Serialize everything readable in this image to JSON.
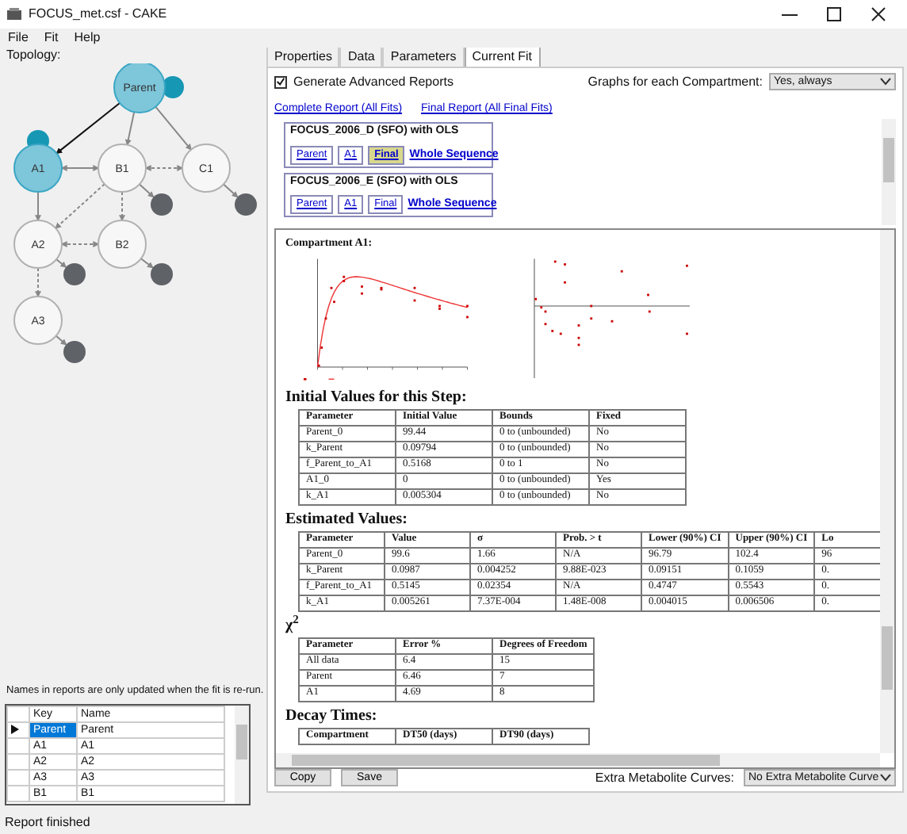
{
  "window": {
    "title": "FOCUS_met.csf - CAKE"
  },
  "menu": [
    "File",
    "Fit",
    "Help"
  ],
  "topology": {
    "label": "Topology:",
    "nodes": [
      {
        "label": "Parent",
        "selected": true,
        "sink": {
          "color": "#1697b4"
        }
      },
      {
        "label": "A1",
        "selected": true,
        "sink": {
          "color": "#1697b4"
        }
      },
      {
        "label": "B1",
        "selected": false,
        "sink": {
          "color": "#5f6266"
        }
      },
      {
        "label": "C1",
        "selected": false,
        "sink": {
          "color": "#5f6266"
        }
      },
      {
        "label": "A2",
        "selected": false,
        "sink": {
          "color": "#5f6266"
        }
      },
      {
        "label": "B2",
        "selected": false,
        "sink": {
          "color": "#5f6266"
        }
      },
      {
        "label": "A3",
        "selected": false,
        "sink": {
          "color": "#5f6266"
        }
      }
    ]
  },
  "names_note": "Names in reports are only updated when the fit is re-run.",
  "names_grid": {
    "columns": [
      "Key",
      "Name"
    ],
    "rows": [
      {
        "key": "Parent",
        "name": "Parent",
        "selected": true
      },
      {
        "key": "A1",
        "name": "A1",
        "selected": false
      },
      {
        "key": "A2",
        "name": "A2",
        "selected": false
      },
      {
        "key": "A3",
        "name": "A3",
        "selected": false
      },
      {
        "key": "B1",
        "name": "B1",
        "selected": false
      }
    ]
  },
  "tabs": [
    {
      "label": "Properties",
      "selected": false
    },
    {
      "label": "Data",
      "selected": false
    },
    {
      "label": "Parameters",
      "selected": false
    },
    {
      "label": "Current Fit",
      "selected": true
    }
  ],
  "advanced_reports": {
    "label": "Generate Advanced Reports",
    "checked": true
  },
  "graphs_setting": {
    "label": "Graphs for each Compartment:",
    "value": "Yes, always"
  },
  "report_links": [
    "Complete Report (All Fits)",
    "Final Report (All Final Fits)"
  ],
  "fits": [
    {
      "title": "FOCUS_2006_D (SFO) with OLS",
      "steps": [
        {
          "label": "Parent",
          "selected": false
        },
        {
          "label": "A1",
          "selected": false
        },
        {
          "label": "Final",
          "selected": true
        }
      ],
      "sequence_link": "Whole Sequence"
    },
    {
      "title": "FOCUS_2006_E (SFO) with OLS",
      "steps": [
        {
          "label": "Parent",
          "selected": false
        },
        {
          "label": "A1",
          "selected": false
        },
        {
          "label": "Final",
          "selected": false
        }
      ],
      "sequence_link": "Whole Sequence"
    }
  ],
  "report": {
    "heading": "Compartment A1:",
    "initial_values": {
      "title": "Initial Values for this Step:",
      "columns": [
        "Parameter",
        "Initial Value",
        "Bounds",
        "Fixed"
      ],
      "rows": [
        [
          "Parent_0",
          "99.44",
          "0 to (unbounded)",
          "No"
        ],
        [
          "k_Parent",
          "0.09794",
          "0 to (unbounded)",
          "No"
        ],
        [
          "f_Parent_to_A1",
          "0.5168",
          "0 to 1",
          "No"
        ],
        [
          "A1_0",
          "0",
          "0 to (unbounded)",
          "Yes"
        ],
        [
          "k_A1",
          "0.005304",
          "0 to (unbounded)",
          "No"
        ]
      ]
    },
    "estimated_values": {
      "title": "Estimated Values:",
      "columns": [
        "Parameter",
        "Value",
        "σ",
        "Prob. > t",
        "Lower (90%) CI",
        "Upper (90%) CI",
        "Lo"
      ],
      "rows": [
        [
          "Parent_0",
          "99.6",
          "1.66",
          "N/A",
          "96.79",
          "102.4",
          "96"
        ],
        [
          "k_Parent",
          "0.0987",
          "0.004252",
          "9.88E-023",
          "0.09151",
          "0.1059",
          "0."
        ],
        [
          "f_Parent_to_A1",
          "0.5145",
          "0.02354",
          "N/A",
          "0.4747",
          "0.5543",
          "0."
        ],
        [
          "k_A1",
          "0.005261",
          "7.37E-004",
          "1.48E-008",
          "0.004015",
          "0.006506",
          "0."
        ]
      ]
    },
    "chi_squared": {
      "title": "χ$^{2}$",
      "columns": [
        "Parameter",
        "Error %",
        "Degrees of Freedom"
      ],
      "rows": [
        [
          "All data",
          "6.4",
          "15"
        ],
        [
          "Parent",
          "6.46",
          "7"
        ],
        [
          "A1",
          "4.69",
          "8"
        ]
      ]
    },
    "decay_times": {
      "title": "Decay Times:",
      "columns": [
        "Compartment",
        "DT50 (days)",
        "DT90 (days)"
      ]
    }
  },
  "actions": [
    "Copy",
    "Save"
  ],
  "extra_curves": {
    "label": "Extra Metabolite Curves:",
    "value": "No Extra Metabolite Curve"
  },
  "status_bar": "Report finished"
}
